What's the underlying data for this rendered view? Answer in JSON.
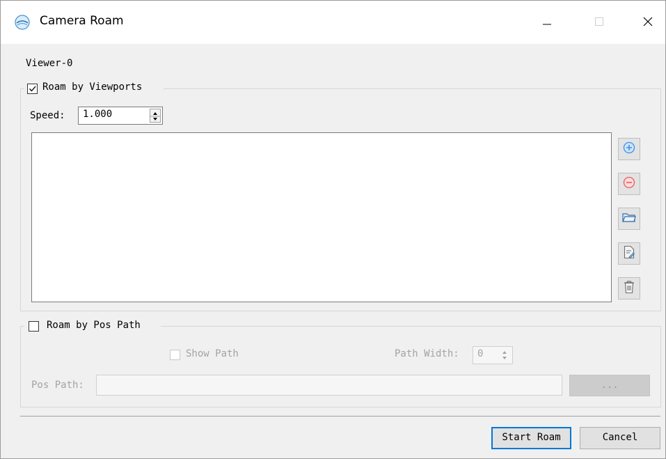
{
  "window": {
    "title": "Camera Roam"
  },
  "viewer_label": "Viewer-0",
  "roam_viewports": {
    "label": "Roam by Viewports",
    "checked": true,
    "speed_label": "Speed:",
    "speed_value": "1.000"
  },
  "toolbar": {
    "icons": [
      "add-icon",
      "remove-icon",
      "open-folder-icon",
      "edit-icon",
      "delete-icon"
    ]
  },
  "roam_pospath": {
    "label": "Roam by Pos Path",
    "checked": false,
    "show_path_label": "Show Path",
    "path_width_label": "Path Width:",
    "path_width_value": "0",
    "pos_path_label": "Pos Path:",
    "pos_path_value": "",
    "browse_label": "..."
  },
  "footer": {
    "start_label": "Start Roam",
    "cancel_label": "Cancel"
  },
  "colors": {
    "accent": "#0078d7",
    "add": "#3d8ee6",
    "remove": "#e06060"
  }
}
